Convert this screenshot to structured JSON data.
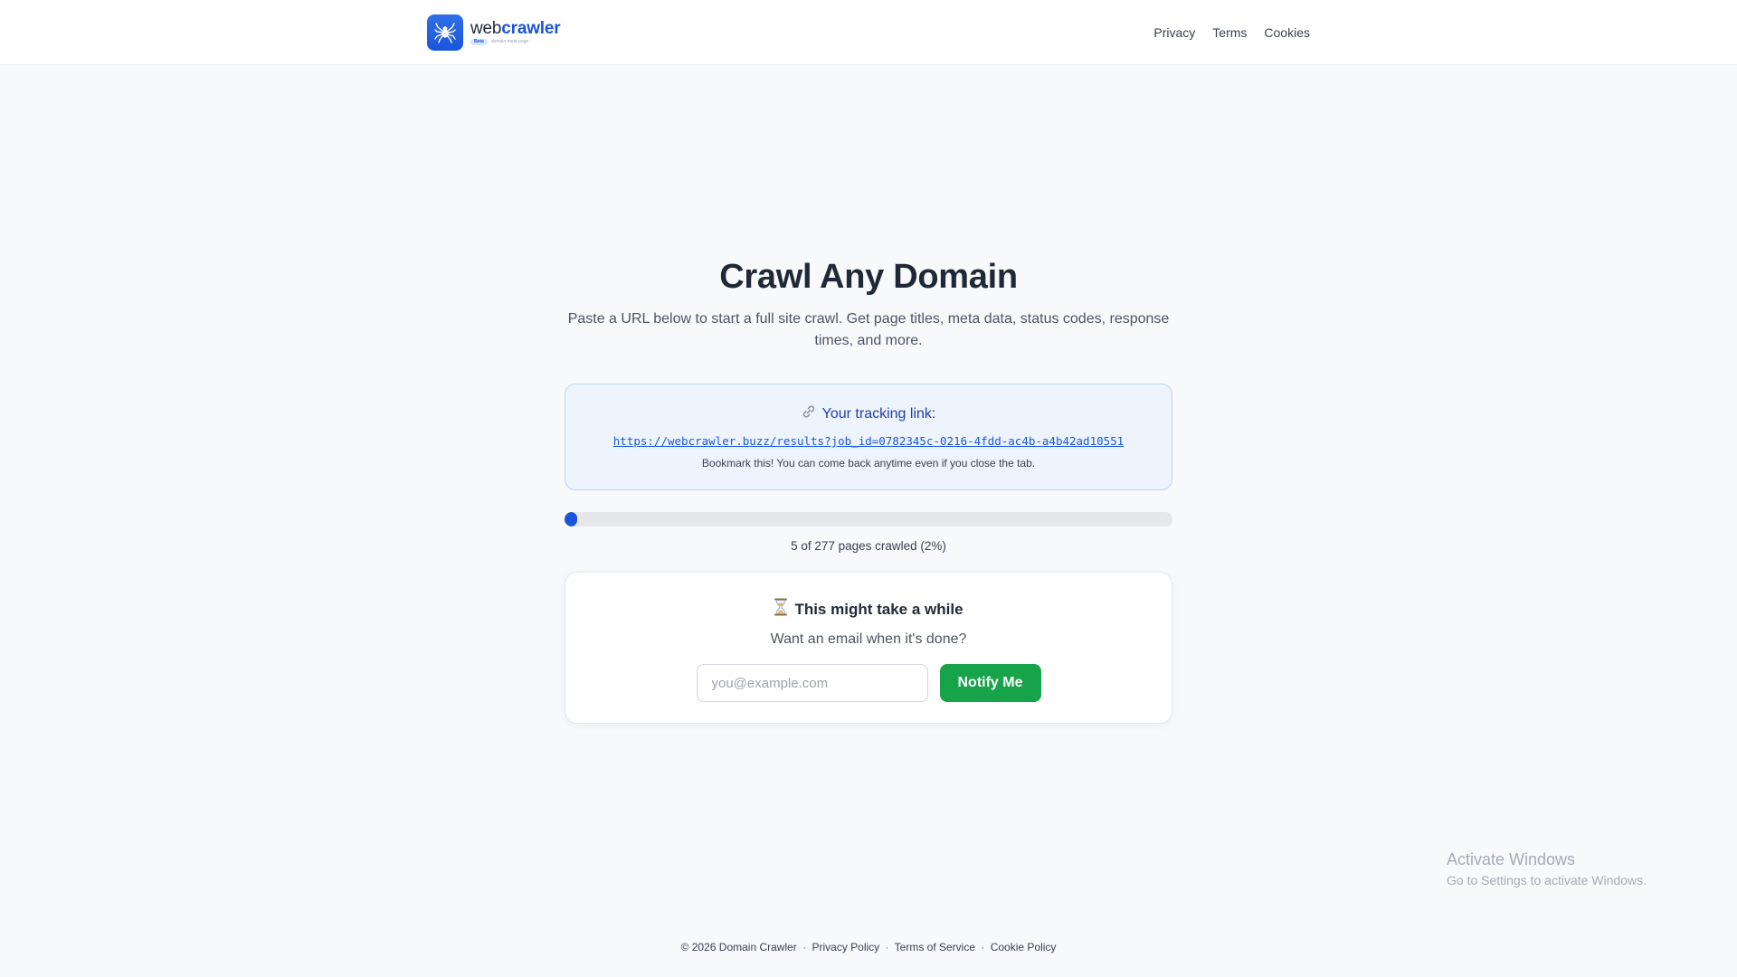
{
  "brand": {
    "name_part1": "web",
    "name_part2": "crawler",
    "badge": "Beta",
    "tagline": "domain meta page",
    "primary_color": "#1a56db"
  },
  "nav": {
    "privacy": "Privacy",
    "terms": "Terms",
    "cookies": "Cookies"
  },
  "hero": {
    "title": "Crawl Any Domain",
    "subtitle": "Paste a URL below to start a full site crawl. Get page titles, meta data, status codes, response times, and more."
  },
  "tracking": {
    "icon": "link-icon",
    "heading": "Your tracking link:",
    "url": "https://webcrawler.buzz/results?job_id=0782345c-0216-4fdd-ac4b-a4b42ad10551",
    "note": "Bookmark this! You can come back anytime even if you close the tab."
  },
  "progress": {
    "crawled": 5,
    "total": 277,
    "percent": 2,
    "text": "5 of 277 pages crawled (2%)"
  },
  "notify": {
    "icon": "hourglass-icon",
    "heading": "This might take a while",
    "subtext": "Want an email when it's done?",
    "email_placeholder": "you@example.com",
    "email_value": "",
    "button_label": "Notify Me",
    "button_color": "#16a34a"
  },
  "watermark": {
    "title": "Activate Windows",
    "subtitle": "Go to Settings to activate Windows."
  },
  "footer": {
    "copyright": "© 2026 Domain Crawler",
    "sep": "·",
    "privacy_policy": "Privacy Policy",
    "terms_of_service": "Terms of Service",
    "cookie_policy": "Cookie Policy"
  }
}
